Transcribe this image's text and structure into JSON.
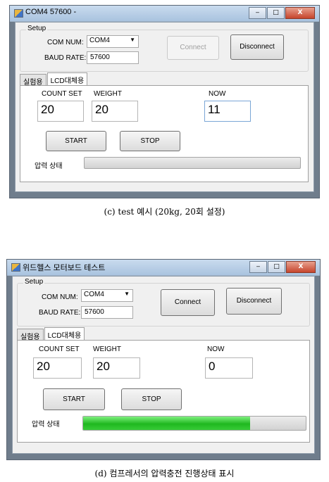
{
  "figures": [
    {
      "window": {
        "title": "COM4  57600 -",
        "buttons": {
          "minimize": "‒",
          "maximize": "□",
          "close": "X"
        }
      },
      "setup": {
        "legend": "Setup",
        "com_label": "COM NUM:",
        "com_value": "COM4",
        "baud_label": "BAUD RATE:",
        "baud_value": "57600",
        "connect_label": "Connect",
        "disconnect_label": "Disconnect"
      },
      "tabs": [
        "실험용",
        "LCD대체용"
      ],
      "fields": {
        "count_label": "COUNT SET",
        "count_value": "20",
        "weight_label": "WEIGHT",
        "weight_value": "20",
        "now_label": "NOW",
        "now_value": "11"
      },
      "start_label": "START",
      "stop_label": "STOP",
      "pressure_label": "압력 상태",
      "progress": 0,
      "caption": "(c) test 예시 (20kg, 20회 설정)"
    },
    {
      "window": {
        "title": "위드헬스 모터보드 테스트",
        "buttons": {
          "minimize": "‒",
          "maximize": "□",
          "close": "X"
        }
      },
      "setup": {
        "legend": "Setup",
        "com_label": "COM NUM:",
        "com_value": "COM4",
        "baud_label": "BAUD RATE:",
        "baud_value": "57600",
        "connect_label": "Connect",
        "disconnect_label": "Disconnect"
      },
      "tabs": [
        "실험용",
        "LCD대체용"
      ],
      "fields": {
        "count_label": "COUNT SET",
        "count_value": "20",
        "weight_label": "WEIGHT",
        "weight_value": "20",
        "now_label": "NOW",
        "now_value": "0"
      },
      "start_label": "START",
      "stop_label": "STOP",
      "pressure_label": "압력 상태",
      "progress": 0.75,
      "caption": "(d) 컴프레서의 압력충전 진행상태 표시"
    }
  ]
}
